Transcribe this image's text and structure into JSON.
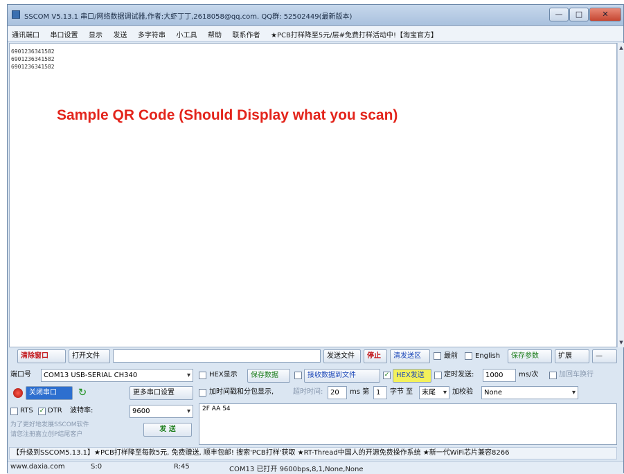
{
  "window": {
    "title": "SSCOM V5.13.1 串口/网络数据调试器,作者:大虾丁丁,2618058@qq.com. QQ群: 52502449(最新版本)",
    "controls": {
      "minimize": "—",
      "maximize": "□",
      "close": "✕"
    }
  },
  "menu": [
    "通讯端口",
    "串口设置",
    "显示",
    "发送",
    "多字符串",
    "小工具",
    "帮助",
    "联系作者",
    "★PCB打样降至5元/层#免费打样活动中!【淘宝官方】"
  ],
  "receive": {
    "lines": [
      "6901236341582",
      "6901236341582",
      "6901236341582"
    ],
    "caption": "Sample QR Code (Should Display what you scan)"
  },
  "toolbar1": {
    "clear_window": "清除窗口",
    "open_file": "打开文件",
    "file_path": "",
    "send_file": "发送文件",
    "stop": "停止",
    "clear_send": "清发送区",
    "top_label": "最前",
    "english_label": "English",
    "save_params": "保存参数",
    "expand": "扩展",
    "collapse": "—"
  },
  "port": {
    "label": "端口号",
    "value": "COM13 USB-SERIAL CH340",
    "hex_display_label": "HEX显示",
    "save_data": "保存数据",
    "recv_to_file": "接收数据到文件",
    "hex_send_label": "HEX发送",
    "timed_send_label": "定时发送:",
    "interval_value": "1000",
    "interval_unit": "ms/次",
    "add_crlf": "加回车换行"
  },
  "row3": {
    "open_port": "关闭串口",
    "more_settings": "更多串口设置",
    "timestamp_label": "加时间戳和分包显示,",
    "timeout_label": "超时时间:",
    "timeout_value": "20",
    "ms_label": "ms 第",
    "byte_value": "1",
    "byte_label": "字节 至",
    "end_value": "末尾",
    "checksum_label": "加校验",
    "checksum_value": "None"
  },
  "row4": {
    "rts_label": "RTS",
    "dtr_label": "DTR",
    "baud_label": "波特率:",
    "baud_value": "9600",
    "send_content": "2F AA 54"
  },
  "promo": {
    "line1": "为了更好地发展SSCOM软件",
    "line2": "请您注册嘉立创P结尾客户",
    "send_button": "发 送"
  },
  "ticker": "【升级到SSCOM5.13.1】★PCB打样降至每款5元, 免费赠送, 顺丰包邮! 搜索'PCB打样'获取 ★RT-Thread中国人的开源免费操作系统 ★新一代WiFi芯片兼容8266",
  "status": {
    "website": "www.daxia.com",
    "s": "S:0",
    "r": "R:45",
    "port_status": "COM13 已打开  9600bps,8,1,None,None"
  }
}
